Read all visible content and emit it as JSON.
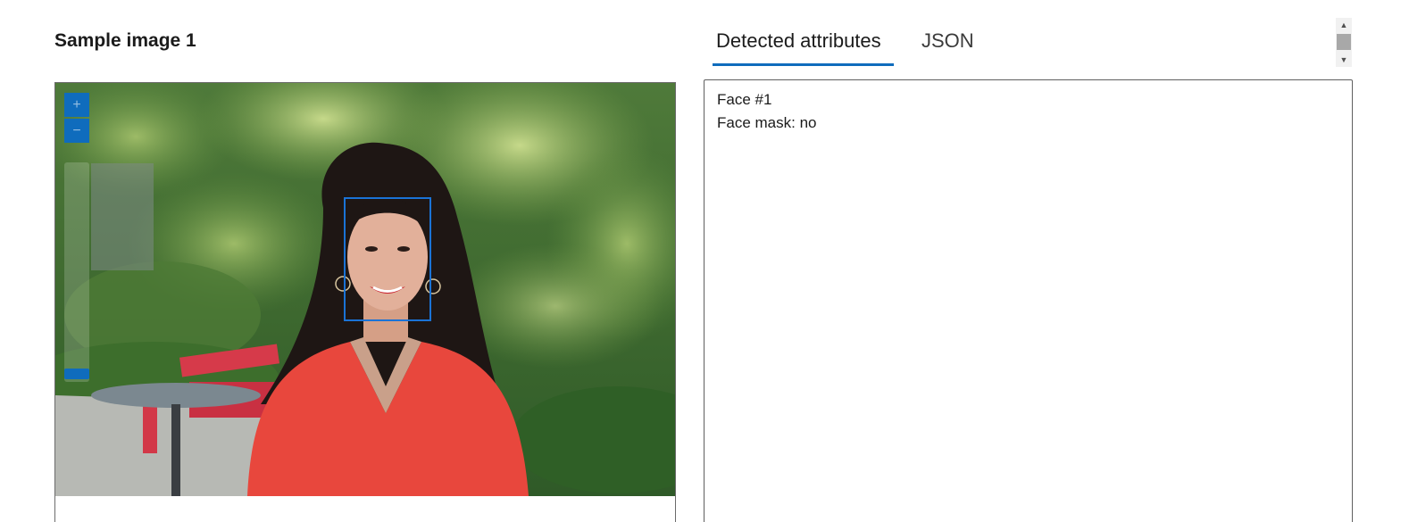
{
  "sample": {
    "title": "Sample image 1"
  },
  "viewer": {
    "zoom_in_icon": "plus-icon",
    "zoom_out_icon": "minus-icon",
    "zoom_in_label": "+",
    "zoom_out_label": "−"
  },
  "tabs": [
    {
      "label": "Detected attributes",
      "active": true
    },
    {
      "label": "JSON",
      "active": false
    }
  ],
  "results": {
    "face_label": "Face #1",
    "mask_label": "Face mask: no"
  },
  "colors": {
    "accent": "#0f6cbd",
    "face_box": "#1a73d6"
  }
}
